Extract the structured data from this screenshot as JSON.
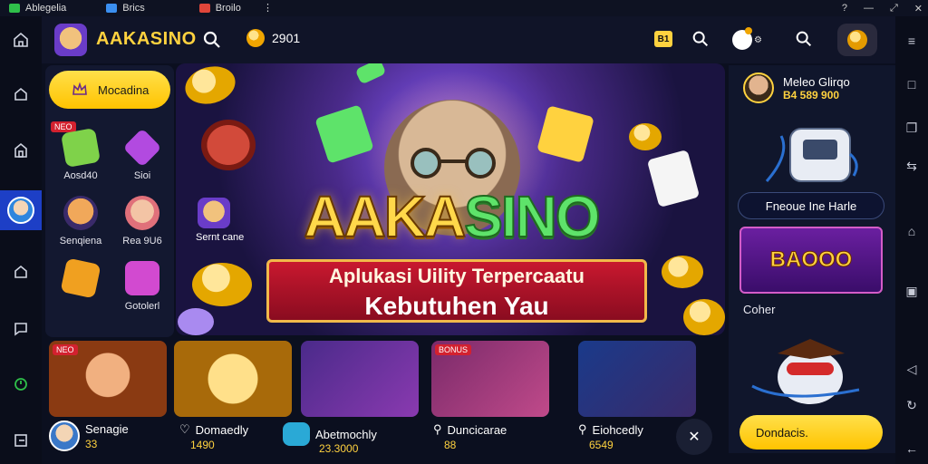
{
  "titlebar": {
    "tabs": [
      {
        "label": "Ablegelia",
        "color": "#2fbf4a"
      },
      {
        "label": "Brics",
        "color": "#3b8ff0"
      },
      {
        "label": "Broilo",
        "color": "#e0463a"
      }
    ]
  },
  "header": {
    "logo_text": "AAKASINO",
    "balance": "2901",
    "tag": "B1"
  },
  "sidebar": {
    "primary_button": "Mocadina",
    "new_badge": "NEO",
    "items": [
      {
        "label": "Aosd40",
        "icon": "green-dice-icon",
        "color": "#7fd24a"
      },
      {
        "label": "Sioi",
        "icon": "purple-gem-icon",
        "color": "#b24ae0"
      },
      {
        "label": "Senqiena",
        "icon": "cat-mascot-icon",
        "color": "#f1a85a"
      },
      {
        "label": "Rea 9U6",
        "icon": "girl-avatar-icon",
        "color": "#e0707a"
      },
      {
        "label": "",
        "icon": "orange-card-icon",
        "color": "#f0a020"
      },
      {
        "label": "Gotolerl",
        "icon": "magenta-card-icon",
        "color": "#d24ad0"
      }
    ]
  },
  "hero": {
    "title_part1": "AAKA",
    "title_part2": "SINO",
    "subtitle": "Aplukasi Uility Terpercaatu",
    "tagline": "Kebutuhen Yau",
    "mini_label": "Sernt cane"
  },
  "promo": {
    "user_name": "Meleo Glirqo",
    "balance": "B4 589 900",
    "pill_label": "Fneoue Ine Harle",
    "card_text": "BAOOO",
    "section_label": "Coher",
    "cta_label": "Dondacis."
  },
  "games": [
    {
      "title": "Senagie",
      "value": "33",
      "badge": "NEO",
      "bg": "#8a3a12"
    },
    {
      "title": "Domaedly",
      "value": "1490",
      "badge": "",
      "bg": "#a86a0a"
    },
    {
      "title": "Abetmochly",
      "value": "23.3000",
      "badge": "",
      "bg": "#4a2a8a"
    },
    {
      "title": "Duncicarae",
      "value": "88",
      "badge": "BONUS",
      "bg": "#7a2a6a"
    },
    {
      "title": "Eiohcedly",
      "value": "6549",
      "badge": "",
      "bg": "#1a3a8a"
    }
  ],
  "colors": {
    "accent_yellow": "#ffd23f",
    "rail_active": "#1d3fc6",
    "badge_red": "#d3212f"
  }
}
